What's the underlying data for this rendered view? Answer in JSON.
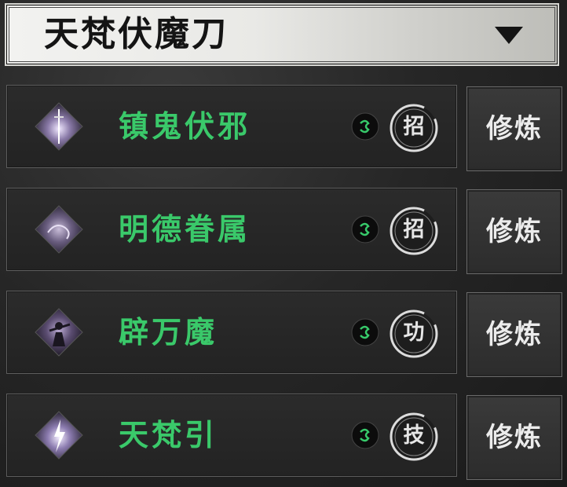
{
  "header": {
    "selected_weapon": "天梵伏魔刀",
    "dropdown_icon": "triangle-down-icon"
  },
  "skills": [
    {
      "name": "镇鬼伏邪",
      "type_label": "招",
      "action_label": "修炼",
      "icon": "sword-diamond-icon",
      "element_icon": "wind-swirl-icon"
    },
    {
      "name": "明德眷属",
      "type_label": "招",
      "action_label": "修炼",
      "icon": "smoke-diamond-icon",
      "element_icon": "wind-swirl-icon"
    },
    {
      "name": "辟万魔",
      "type_label": "功",
      "action_label": "修炼",
      "icon": "warrior-diamond-icon",
      "element_icon": "wind-swirl-icon"
    },
    {
      "name": "天梵引",
      "type_label": "技",
      "action_label": "修炼",
      "icon": "lightning-diamond-icon",
      "element_icon": "wind-swirl-icon"
    }
  ],
  "colors": {
    "skill_name": "#3ac96a",
    "header_bg": "#e9e9e6",
    "panel_bg": "#262626"
  }
}
